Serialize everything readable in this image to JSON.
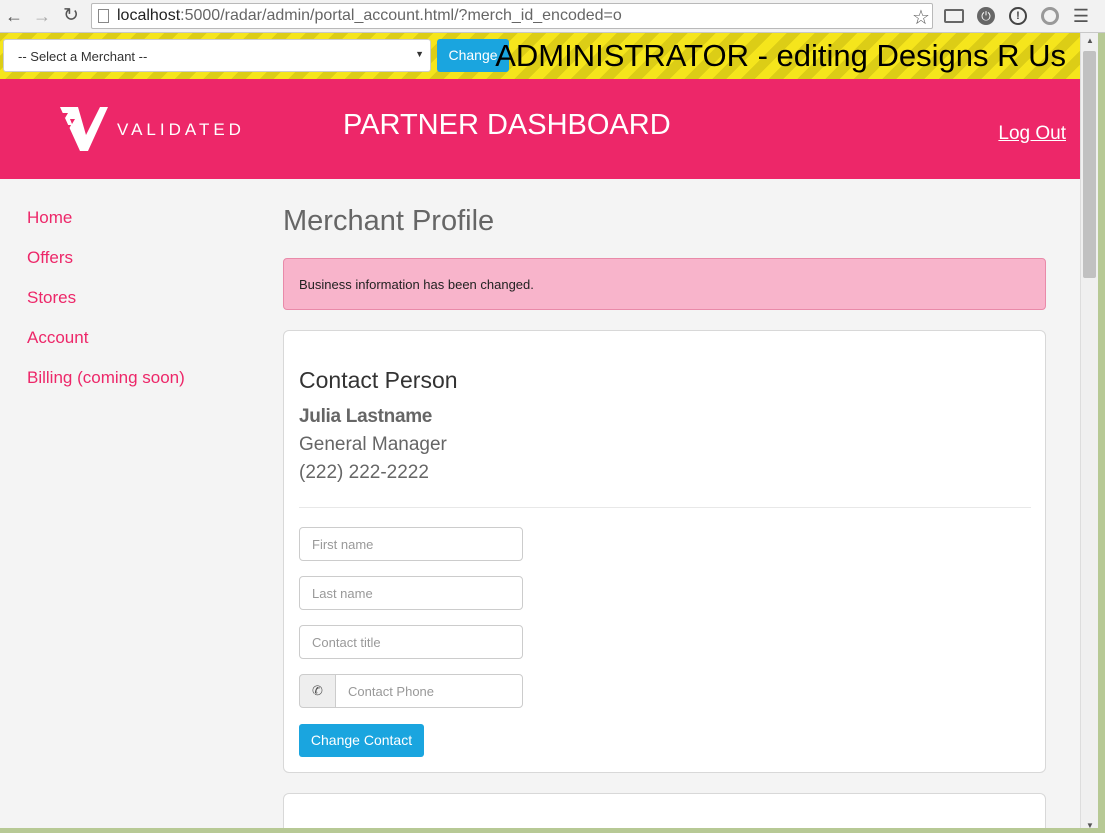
{
  "browser": {
    "url_host": "localhost",
    "url_rest": ":5000/radar/admin/portal_account.html/?merch_id_encoded=o"
  },
  "admin_bar": {
    "select_value": "-- Select a Merchant --",
    "change_label": "Change",
    "title": "ADMINISTRATOR - editing Designs R Us"
  },
  "header": {
    "logo_text": "VALIDATED",
    "title": "PARTNER DASHBOARD",
    "logout_label": "Log Out"
  },
  "sidebar": {
    "items": [
      {
        "label": "Home"
      },
      {
        "label": "Offers"
      },
      {
        "label": "Stores"
      },
      {
        "label": "Account"
      },
      {
        "label": "Billing (coming soon)"
      }
    ]
  },
  "main": {
    "title": "Merchant Profile",
    "alert": "Business information has been changed.",
    "contact": {
      "heading": "Contact Person",
      "name": "Julia Lastname",
      "role": "General Manager",
      "phone": "(222) 222-2222"
    },
    "form": {
      "first_name_placeholder": "First name",
      "last_name_placeholder": "Last name",
      "title_placeholder": "Contact title",
      "phone_placeholder": "Contact Phone",
      "submit_label": "Change Contact"
    }
  },
  "colors": {
    "brand": "#ed2769",
    "button": "#1aa5df",
    "admin_bar": "#f5e51c",
    "alert_bg": "#f8b4cb"
  }
}
